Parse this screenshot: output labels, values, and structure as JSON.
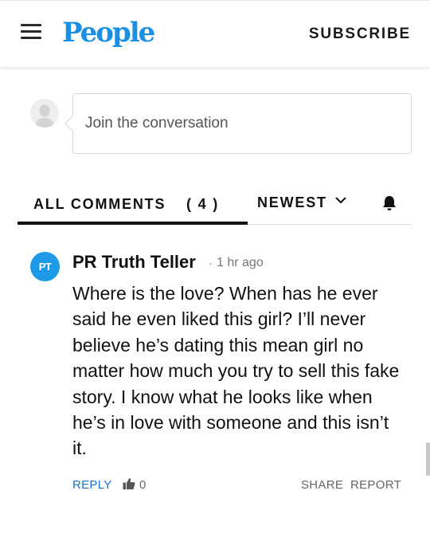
{
  "header": {
    "logo": "People",
    "subscribe_label": "SUBSCRIBE"
  },
  "composer": {
    "placeholder": "Join the conversation"
  },
  "tabs": {
    "all_comments_label": "ALL COMMENTS",
    "count": "( 4 )",
    "sort_label": "NEWEST"
  },
  "comments": [
    {
      "avatar_initials": "PT",
      "avatar_color": "#1f9ae6",
      "author": "PR Truth Teller",
      "separator": "·",
      "time": "1 hr ago",
      "body": "Where is the love? When has he ever said he even liked this girl? I’ll never believe he’s dating this mean girl no matter how much you try to sell this fake story. I know what he looks like when he’s in love with someone and this isn’t it.",
      "reply_label": "REPLY",
      "like_count": "0",
      "share_label": "SHARE",
      "report_label": "REPORT"
    }
  ],
  "icons": {
    "menu": "hamburger-menu-icon",
    "avatar_placeholder": "user-silhouette-icon",
    "chevron": "chevron-down-icon",
    "bell": "bell-icon",
    "like": "thumbs-up-icon"
  },
  "colors": {
    "brand": "#1a8fe3",
    "link": "#1a73c9"
  }
}
